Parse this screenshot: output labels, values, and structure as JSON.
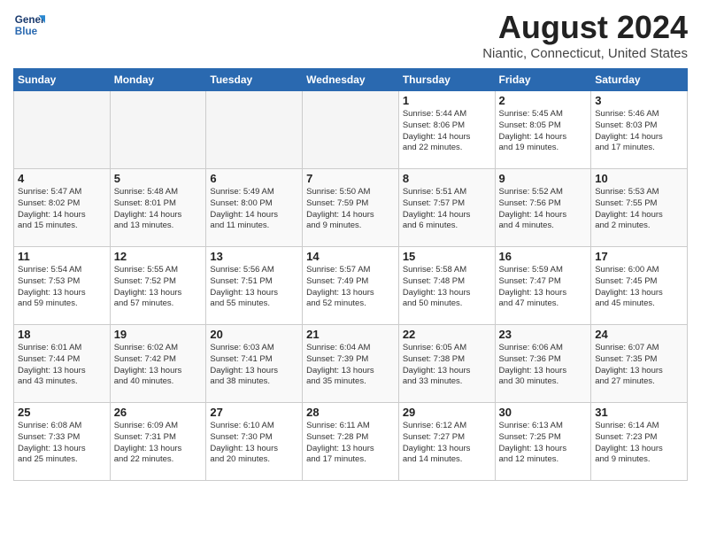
{
  "logo": {
    "line1": "General",
    "line2": "Blue"
  },
  "title": "August 2024",
  "location": "Niantic, Connecticut, United States",
  "days_of_week": [
    "Sunday",
    "Monday",
    "Tuesday",
    "Wednesday",
    "Thursday",
    "Friday",
    "Saturday"
  ],
  "weeks": [
    [
      {
        "num": "",
        "empty": true
      },
      {
        "num": "",
        "empty": true
      },
      {
        "num": "",
        "empty": true
      },
      {
        "num": "",
        "empty": true
      },
      {
        "num": "1",
        "info": "Sunrise: 5:44 AM\nSunset: 8:06 PM\nDaylight: 14 hours\nand 22 minutes."
      },
      {
        "num": "2",
        "info": "Sunrise: 5:45 AM\nSunset: 8:05 PM\nDaylight: 14 hours\nand 19 minutes."
      },
      {
        "num": "3",
        "info": "Sunrise: 5:46 AM\nSunset: 8:03 PM\nDaylight: 14 hours\nand 17 minutes."
      }
    ],
    [
      {
        "num": "4",
        "info": "Sunrise: 5:47 AM\nSunset: 8:02 PM\nDaylight: 14 hours\nand 15 minutes."
      },
      {
        "num": "5",
        "info": "Sunrise: 5:48 AM\nSunset: 8:01 PM\nDaylight: 14 hours\nand 13 minutes."
      },
      {
        "num": "6",
        "info": "Sunrise: 5:49 AM\nSunset: 8:00 PM\nDaylight: 14 hours\nand 11 minutes."
      },
      {
        "num": "7",
        "info": "Sunrise: 5:50 AM\nSunset: 7:59 PM\nDaylight: 14 hours\nand 9 minutes."
      },
      {
        "num": "8",
        "info": "Sunrise: 5:51 AM\nSunset: 7:57 PM\nDaylight: 14 hours\nand 6 minutes."
      },
      {
        "num": "9",
        "info": "Sunrise: 5:52 AM\nSunset: 7:56 PM\nDaylight: 14 hours\nand 4 minutes."
      },
      {
        "num": "10",
        "info": "Sunrise: 5:53 AM\nSunset: 7:55 PM\nDaylight: 14 hours\nand 2 minutes."
      }
    ],
    [
      {
        "num": "11",
        "info": "Sunrise: 5:54 AM\nSunset: 7:53 PM\nDaylight: 13 hours\nand 59 minutes."
      },
      {
        "num": "12",
        "info": "Sunrise: 5:55 AM\nSunset: 7:52 PM\nDaylight: 13 hours\nand 57 minutes."
      },
      {
        "num": "13",
        "info": "Sunrise: 5:56 AM\nSunset: 7:51 PM\nDaylight: 13 hours\nand 55 minutes."
      },
      {
        "num": "14",
        "info": "Sunrise: 5:57 AM\nSunset: 7:49 PM\nDaylight: 13 hours\nand 52 minutes."
      },
      {
        "num": "15",
        "info": "Sunrise: 5:58 AM\nSunset: 7:48 PM\nDaylight: 13 hours\nand 50 minutes."
      },
      {
        "num": "16",
        "info": "Sunrise: 5:59 AM\nSunset: 7:47 PM\nDaylight: 13 hours\nand 47 minutes."
      },
      {
        "num": "17",
        "info": "Sunrise: 6:00 AM\nSunset: 7:45 PM\nDaylight: 13 hours\nand 45 minutes."
      }
    ],
    [
      {
        "num": "18",
        "info": "Sunrise: 6:01 AM\nSunset: 7:44 PM\nDaylight: 13 hours\nand 43 minutes."
      },
      {
        "num": "19",
        "info": "Sunrise: 6:02 AM\nSunset: 7:42 PM\nDaylight: 13 hours\nand 40 minutes."
      },
      {
        "num": "20",
        "info": "Sunrise: 6:03 AM\nSunset: 7:41 PM\nDaylight: 13 hours\nand 38 minutes."
      },
      {
        "num": "21",
        "info": "Sunrise: 6:04 AM\nSunset: 7:39 PM\nDaylight: 13 hours\nand 35 minutes."
      },
      {
        "num": "22",
        "info": "Sunrise: 6:05 AM\nSunset: 7:38 PM\nDaylight: 13 hours\nand 33 minutes."
      },
      {
        "num": "23",
        "info": "Sunrise: 6:06 AM\nSunset: 7:36 PM\nDaylight: 13 hours\nand 30 minutes."
      },
      {
        "num": "24",
        "info": "Sunrise: 6:07 AM\nSunset: 7:35 PM\nDaylight: 13 hours\nand 27 minutes."
      }
    ],
    [
      {
        "num": "25",
        "info": "Sunrise: 6:08 AM\nSunset: 7:33 PM\nDaylight: 13 hours\nand 25 minutes."
      },
      {
        "num": "26",
        "info": "Sunrise: 6:09 AM\nSunset: 7:31 PM\nDaylight: 13 hours\nand 22 minutes."
      },
      {
        "num": "27",
        "info": "Sunrise: 6:10 AM\nSunset: 7:30 PM\nDaylight: 13 hours\nand 20 minutes."
      },
      {
        "num": "28",
        "info": "Sunrise: 6:11 AM\nSunset: 7:28 PM\nDaylight: 13 hours\nand 17 minutes."
      },
      {
        "num": "29",
        "info": "Sunrise: 6:12 AM\nSunset: 7:27 PM\nDaylight: 13 hours\nand 14 minutes."
      },
      {
        "num": "30",
        "info": "Sunrise: 6:13 AM\nSunset: 7:25 PM\nDaylight: 13 hours\nand 12 minutes."
      },
      {
        "num": "31",
        "info": "Sunrise: 6:14 AM\nSunset: 7:23 PM\nDaylight: 13 hours\nand 9 minutes."
      }
    ]
  ]
}
